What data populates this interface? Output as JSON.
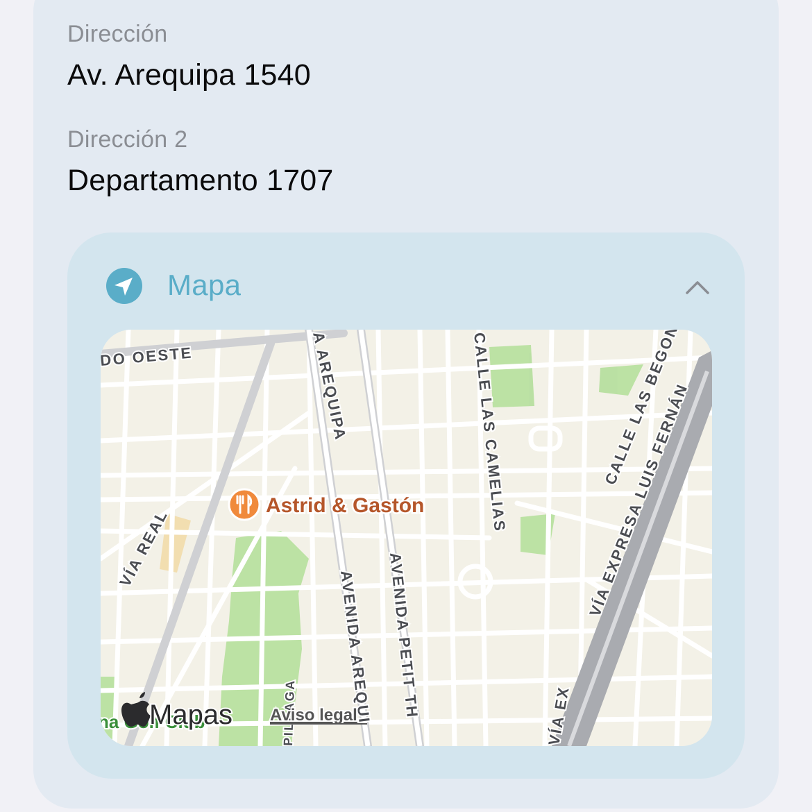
{
  "address": {
    "label": "Dirección",
    "value": "Av. Arequipa 1540"
  },
  "address2": {
    "label": "Dirección 2",
    "value": "Departamento 1707"
  },
  "map_section": {
    "title": "Mapa",
    "icon": "location-arrow-icon",
    "collapse_icon": "chevron-up-icon",
    "accent_color": "#5aadc8"
  },
  "map": {
    "streets": {
      "north": "DO OESTE",
      "arequipa_top": "A AREQUIPA",
      "camelias": "CALLE LAS CAMELIAS",
      "begonias": "CALLE LAS BEGONI",
      "via_expresa": "VÍA EXPRESA LUIS FERNÁN",
      "via_real": "VÍA REAL",
      "avenida_arequipa": "AVENIDA AREQUI",
      "petit_thouars": "AVENIDA PETIT TH",
      "pillaga": "PILLAGA",
      "via_ex_bottom": "VÍA EX"
    },
    "poi": {
      "name": "Astrid & Gastón",
      "icon": "restaurant-icon",
      "color": "#f08a3c"
    },
    "park_label": "na Golf Club",
    "brand": "Mapas",
    "legal": "Aviso legal"
  }
}
